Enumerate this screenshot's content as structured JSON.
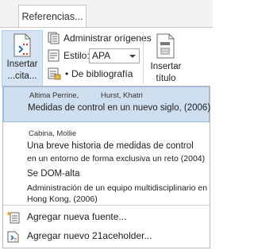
{
  "ribbon": {
    "tab_label": "Referencias...",
    "insert_citation": {
      "line1": "Insertar",
      "line2": "...cita..."
    },
    "manage_sources": "Administrar orígenes",
    "style_label": "Estilo:",
    "style_value": "APA",
    "bibliography": "De bibliografía",
    "insert_title": {
      "line1": "Insertar",
      "line2": "título"
    }
  },
  "citations": [
    {
      "authors": [
        "Altima Perrine,",
        "Hurst, Khatri"
      ],
      "title_lines": [
        "Medidas de control en un nuevo siglo, (2006)"
      ]
    },
    {
      "authors": [
        "Cabina, Mollie"
      ],
      "title_lines": [
        "Una breve historia de medidas de control",
        "en un entorno de forma exclusiva un reto (2004)"
      ]
    },
    {
      "authors": [],
      "title_lines": [
        "Se DOM-alta",
        "Administración de un equipo multidisciplinario en",
        "Hong Kong, (2006)"
      ]
    }
  ],
  "actions": {
    "add_source": "Agregar nueva fuente...",
    "add_placeholder": "Agregar nuevo 21aceholder..."
  },
  "colors": {
    "selected_bg": "#cfdff0",
    "button_bg": "#d5e3f3",
    "accent_blue": "#2b6cb5",
    "accent_red": "#c0392b"
  }
}
